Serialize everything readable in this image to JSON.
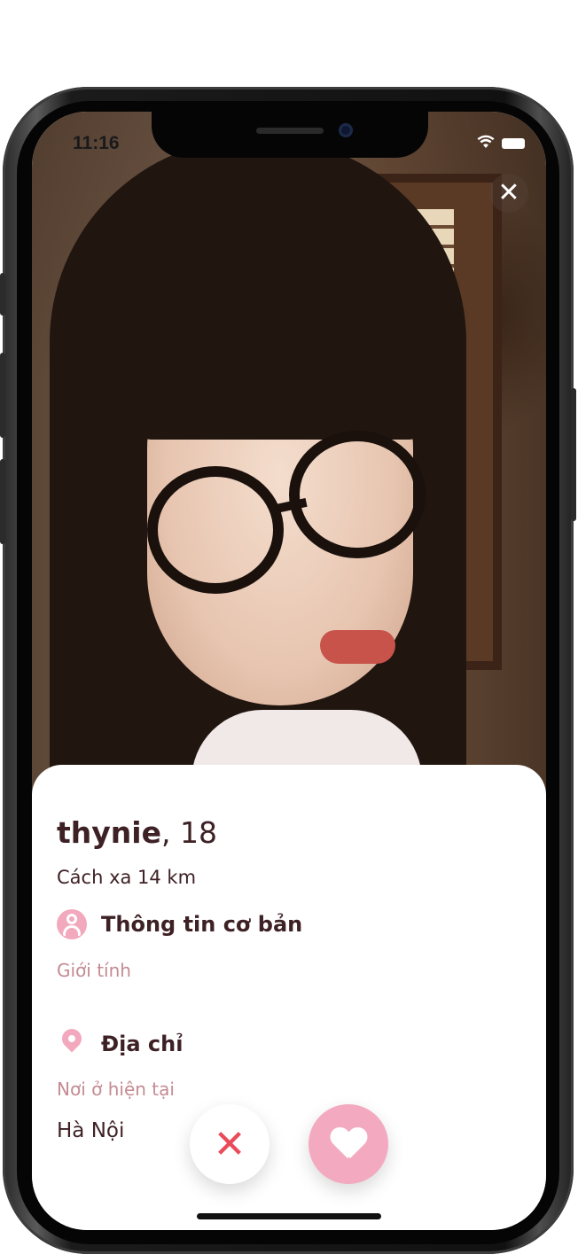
{
  "status_bar": {
    "time": "11:16"
  },
  "profile": {
    "name": "thynie",
    "age": ", 18",
    "distance": "Cách xa 14 km"
  },
  "sections": {
    "basic_info": {
      "title": "Thông tin cơ bản",
      "gender_label": "Giới tính",
      "icon": "person-icon"
    },
    "address": {
      "title": "Địa chỉ",
      "current_label": "Nơi ở hiện tại",
      "current_value": "Hà Nội",
      "icon": "location-pin-icon"
    }
  },
  "actions": {
    "close_glyph": "✕",
    "dislike_glyph": "✕",
    "like_icon": "heart-icon"
  },
  "colors": {
    "accent_pink": "#f3aac0",
    "text_dark": "#3e2125",
    "muted_pink": "#c48b93",
    "dislike_red": "#ea4b5a"
  }
}
